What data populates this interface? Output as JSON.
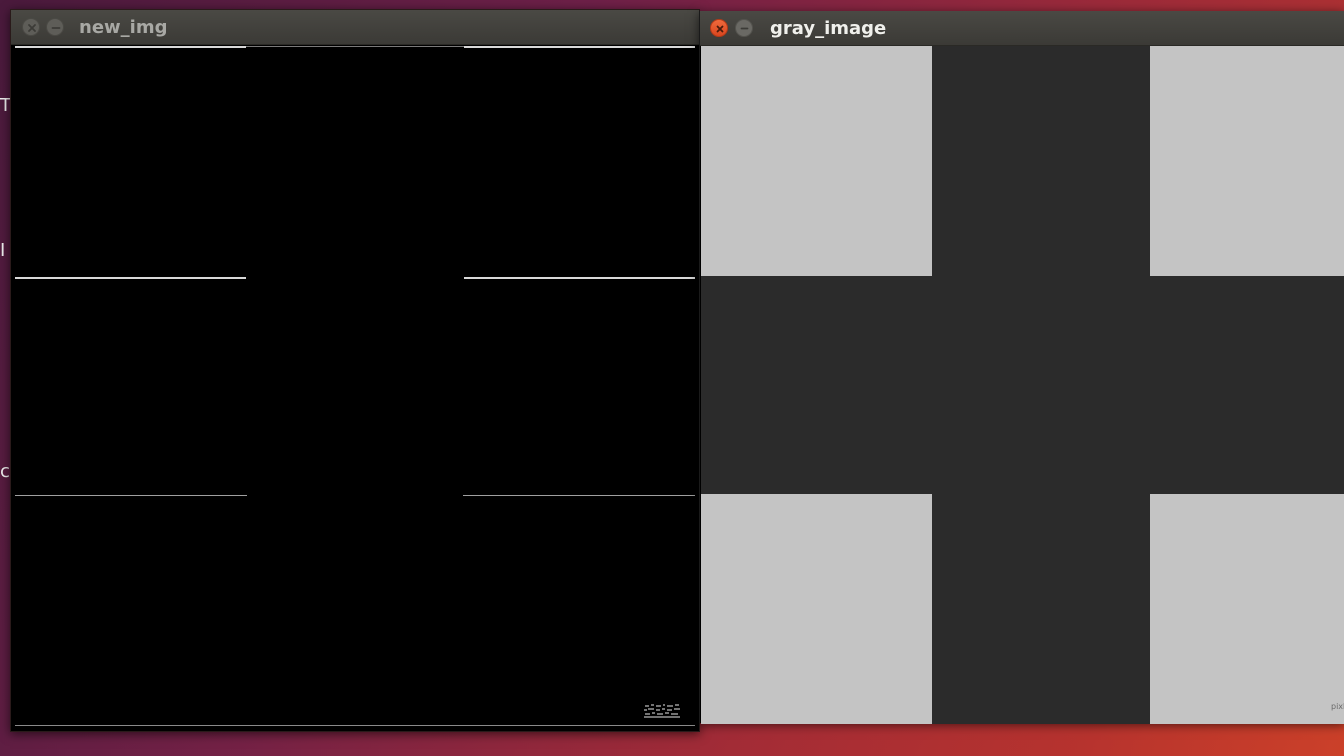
{
  "desktop": {
    "background_gradient": [
      "#4a1a3c",
      "#6e2048",
      "#9b2a3a",
      "#c43a2a"
    ],
    "behind_text": [
      "T",
      "I",
      "ce"
    ]
  },
  "windows": [
    {
      "title": "new_img",
      "close_button_state": "inactive",
      "minimize_button_state": "inactive",
      "title_color": "#a8a8a4",
      "image": {
        "background": "#000000",
        "line_color": "#d8d8d8",
        "noise_text": "&#8203;"
      }
    },
    {
      "title": "gray_image",
      "close_button_state": "active",
      "close_button_color": "#e8512c",
      "minimize_button_state": "inactive",
      "title_color": "#f0f0ec",
      "image": {
        "light_gray": "#c4c4c4",
        "dark_gray": "#2b2b2b",
        "corner_text": "pixl"
      }
    }
  ]
}
